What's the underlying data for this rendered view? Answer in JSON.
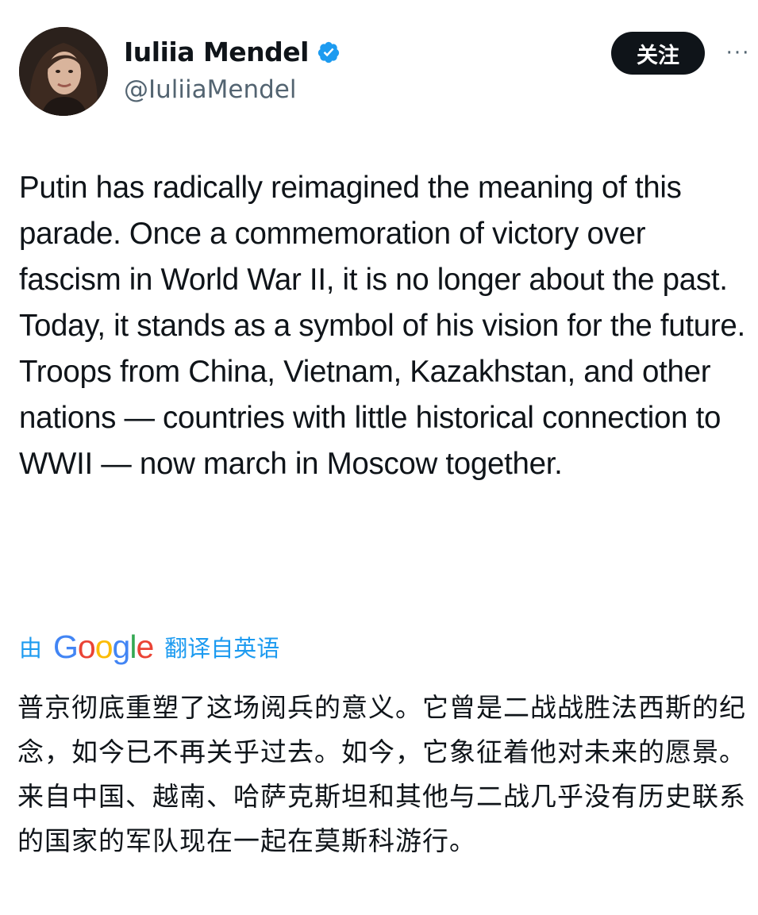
{
  "author": {
    "display_name": "Iuliia Mendel",
    "handle": "@IuliiaMendel",
    "verified": true
  },
  "actions": {
    "follow_label": "关注",
    "more_label": "···"
  },
  "tweet": {
    "paragraphs": [
      "Putin has radically reimagined the meaning of this parade. Once a commemoration of victory over fascism in World War II, it is no longer about the past. Today, it stands as a symbol of his vision for the future.",
      "Troops from China, Vietnam, Kazakhstan, and other nations — countries with little historical connection to WWII — now march in Moscow together."
    ]
  },
  "translation_bar": {
    "prefix": "由",
    "provider": "Google",
    "suffix": "翻译自英语"
  },
  "translation": {
    "paragraphs": [
      "普京彻底重塑了这场阅兵的意义。它曾是二战战胜法西斯的纪念，如今已不再关乎过去。如今，它象征着他对未来的愿景。",
      "来自中国、越南、哈萨克斯坦和其他与二战几乎没有历史联系的国家的军队现在一起在莫斯科游行。"
    ]
  },
  "colors": {
    "text": "#0f1419",
    "secondary": "#536471",
    "link_blue": "#1d9bf0",
    "verified_blue": "#1d9bf0",
    "button_bg": "#0f1419"
  },
  "icons": {
    "verified": "verified-badge-icon",
    "more": "more-dots-icon"
  }
}
